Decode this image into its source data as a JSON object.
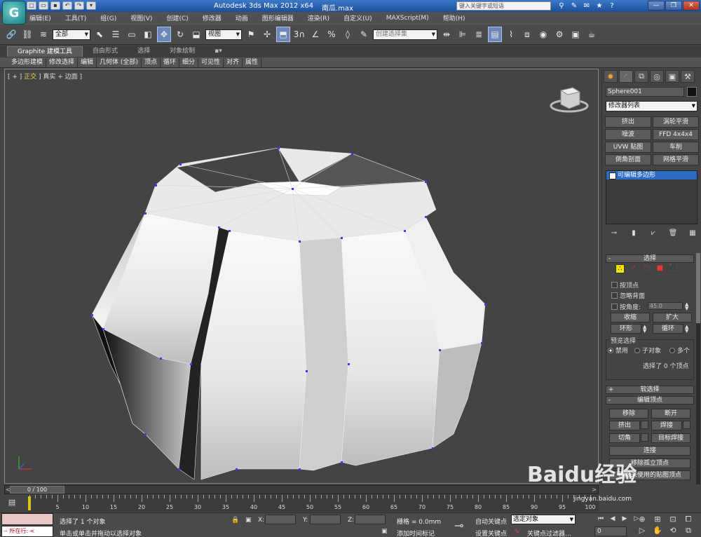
{
  "app": {
    "title": "Autodesk 3ds Max  2012 x64",
    "file": "南瓜.max",
    "search_placeholder": "键入关键字或短语",
    "logo_glyph": "G",
    "accent": "#2d6cc4"
  },
  "menus": [
    "编辑(E)",
    "工具(T)",
    "组(G)",
    "视图(V)",
    "创建(C)",
    "修改器",
    "动画",
    "图形编辑器",
    "渲染(R)",
    "自定义(U)",
    "MAXScript(M)",
    "帮助(H)"
  ],
  "toolbar": {
    "filter_value": "全部",
    "refcoord_value": "视图",
    "selset_placeholder": "创建选择集"
  },
  "ribbon": {
    "tabs": [
      "Graphite 建模工具",
      "自由形式",
      "选择",
      "对象绘制"
    ],
    "active_tab": 0,
    "sub": [
      "多边形建模",
      "修改选择",
      "编辑",
      "几何体 (全部)",
      "顶点",
      "循环",
      "细分",
      "可见性",
      "对齐",
      "属性"
    ]
  },
  "viewport": {
    "label_prefix": "[ + ] ",
    "label_view": "正交",
    "label_rest": " ] 真实 + 边面 ]"
  },
  "command_panel": {
    "object_name": "Sphere001",
    "modifier_list": "修改器列表",
    "modifier_buttons": [
      "挤出",
      "涡轮平滑",
      "噪波",
      "FFD 4x4x4",
      "UVW 贴图",
      "车削",
      "倒角剖面",
      "网格平滑"
    ],
    "stack_item": "可编辑多边形",
    "selection": {
      "title": "选择",
      "by_vertex": "按顶点",
      "ignore_backface": "忽略背面",
      "by_angle": "按角度:",
      "angle_value": "45.0",
      "shrink": "收缩",
      "grow": "扩大",
      "ring": "环形",
      "loop": "循环",
      "preview_title": "预览选择",
      "preview_off": "禁用",
      "preview_sub": "子对象",
      "preview_multi": "多个",
      "status": "选择了 0 个顶点"
    },
    "soft_selection": "软选择",
    "edit_vertices": {
      "title": "编辑顶点",
      "remove": "移除",
      "break": "断开",
      "extrude": "挤出",
      "weld": "焊接",
      "chamfer": "切角",
      "target_weld": "目标焊接",
      "connect": "连接",
      "remove_isolated": "移除孤立顶点",
      "remove_unused_map": "移除未使用的贴图顶点"
    }
  },
  "timeline": {
    "frame": "0 / 100",
    "ticks": [
      0,
      5,
      10,
      15,
      20,
      25,
      30,
      35,
      40,
      45,
      50,
      55,
      60,
      65,
      70,
      75,
      80,
      85,
      90,
      95,
      100
    ],
    "current": 0
  },
  "status": {
    "maxscript_label": "所在行:",
    "line1": "选择了 1 个对象",
    "line2": "单击或单击并拖动以选择对象",
    "x_label": "X:",
    "y_label": "Y:",
    "z_label": "Z:",
    "grid": "栅格 = 0.0mm",
    "add_time_tag": "添加时间标记",
    "auto_key": "自动关键点",
    "set_key": "设置关键点",
    "selected_dropdown": "选定对象",
    "key_filters": "关键点过滤器...",
    "frame_field": "0"
  },
  "watermark": {
    "brand": "Baidu经验",
    "url": "jingyan.baidu.com"
  }
}
